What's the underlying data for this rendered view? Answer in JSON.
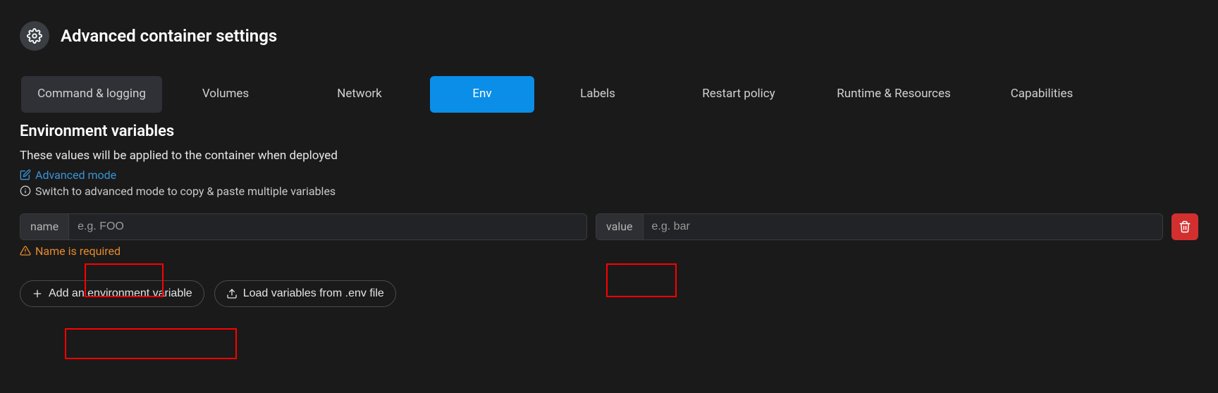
{
  "header": {
    "title": "Advanced container settings"
  },
  "tabs": [
    {
      "label": "Command & logging",
      "active": false
    },
    {
      "label": "Volumes",
      "active": false
    },
    {
      "label": "Network",
      "active": false
    },
    {
      "label": "Env",
      "active": true
    },
    {
      "label": "Labels",
      "active": false
    },
    {
      "label": "Restart policy",
      "active": false
    },
    {
      "label": "Runtime & Resources",
      "active": false
    },
    {
      "label": "Capabilities",
      "active": false
    }
  ],
  "section": {
    "title": "Environment variables",
    "desc": "These values will be applied to the container when deployed",
    "advanced_link": "Advanced mode",
    "hint": "Switch to advanced mode to copy & paste multiple variables"
  },
  "env_row": {
    "name_label": "name",
    "name_placeholder": "e.g. FOO",
    "name_value": "",
    "value_label": "value",
    "value_placeholder": "e.g. bar",
    "value_value": ""
  },
  "warning": "Name is required",
  "actions": {
    "add": "Add an environment variable",
    "load": "Load variables from .env file"
  }
}
